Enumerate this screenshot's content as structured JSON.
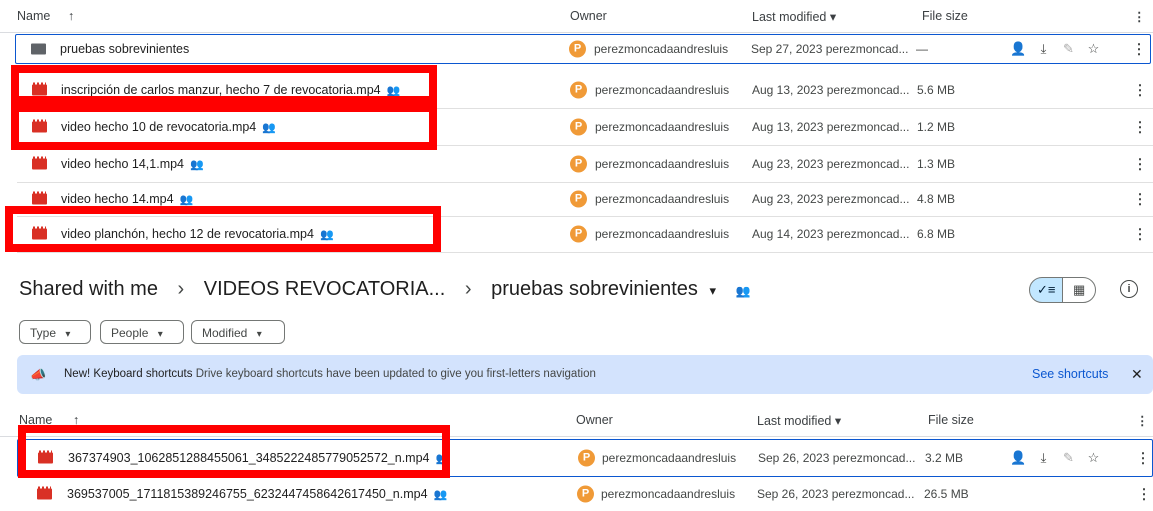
{
  "top_list": {
    "columns": {
      "name": "Name",
      "sort_arrow": "↑",
      "owner": "Owner",
      "modified": "Last modified ▾",
      "size": "File size",
      "more": "⋮"
    },
    "rows": [
      {
        "name": "pruebas sobrevinientes",
        "type": "folder",
        "owner_initial": "P",
        "owner": "perezmoncadaandresluis",
        "modified": "Sep 27, 2023 perezmoncad...",
        "size": "—"
      },
      {
        "name": "inscripción de carlos manzur, hecho 7 de revocatoria.mp4",
        "type": "video",
        "shared": true,
        "owner_initial": "P",
        "owner": "perezmoncadaandresluis",
        "modified": "Aug 13, 2023 perezmoncad...",
        "size": "5.6 MB"
      },
      {
        "name": "video hecho 10 de revocatoria.mp4",
        "type": "video",
        "shared": true,
        "owner_initial": "P",
        "owner": "perezmoncadaandresluis",
        "modified": "Aug 13, 2023 perezmoncad...",
        "size": "1.2 MB"
      },
      {
        "name": "video hecho 14,1.mp4",
        "type": "video",
        "shared": true,
        "owner_initial": "P",
        "owner": "perezmoncadaandresluis",
        "modified": "Aug 23, 2023 perezmoncad...",
        "size": "1.3 MB"
      },
      {
        "name": "video hecho 14.mp4",
        "type": "video",
        "shared": true,
        "owner_initial": "P",
        "owner": "perezmoncadaandresluis",
        "modified": "Aug 23, 2023 perezmoncad...",
        "size": "4.8 MB"
      },
      {
        "name": "video planchón, hecho 12 de revocatoria.mp4",
        "type": "video",
        "shared": true,
        "owner_initial": "P",
        "owner": "perezmoncadaandresluis",
        "modified": "Aug 14, 2023 perezmoncad...",
        "size": "6.8 MB"
      }
    ]
  },
  "breadcrumb": {
    "root": "Shared with me",
    "sep": "›",
    "middle": "VIDEOS REVOCATORIA...",
    "current": "pruebas sobrevinientes",
    "dropdown": "▾"
  },
  "filters": {
    "type": "Type",
    "people": "People",
    "modified": "Modified",
    "caret": "▾"
  },
  "banner": {
    "title": "New! Keyboard shortcuts",
    "text": "Drive keyboard shortcuts have been updated to give you first-letters navigation",
    "link": "See shortcuts",
    "close": "✕"
  },
  "bottom_list": {
    "columns": {
      "name": "Name",
      "sort_arrow": "↑",
      "owner": "Owner",
      "modified": "Last modified ▾",
      "size": "File size",
      "more": "⋮"
    },
    "rows": [
      {
        "name": "367374903_1062851288455061_3485222485779052572_n.mp4",
        "type": "video",
        "shared": true,
        "owner_initial": "P",
        "owner": "perezmoncadaandresluis",
        "modified": "Sep 26, 2023 perezmoncad...",
        "size": "3.2 MB"
      },
      {
        "name": "369537005_1711815389246755_6232447458642617450_n.mp4",
        "type": "video",
        "shared": true,
        "owner_initial": "P",
        "owner": "perezmoncadaandresluis",
        "modified": "Sep 26, 2023 perezmoncad...",
        "size": "26.5 MB"
      }
    ]
  },
  "icons": {
    "shared": "people-icon",
    "video": "video-file-icon",
    "folder": "shared-folder-icon",
    "share_action": "add-person-icon",
    "download": "download-icon",
    "rename": "pencil-icon",
    "star": "star-icon",
    "list_view": "list-view-icon",
    "grid_view": "grid-view-icon",
    "info": "info-icon",
    "announce": "megaphone-icon"
  },
  "colors": {
    "accent": "#0b57d0",
    "banner_bg": "#d3e3fd",
    "owner_avatar": "#f09a37",
    "video_red": "#d93025",
    "highlight_box": "#ff0000"
  }
}
